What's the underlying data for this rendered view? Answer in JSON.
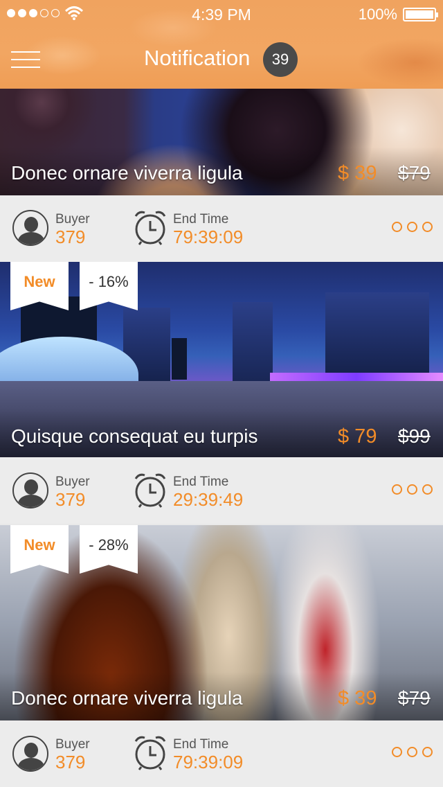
{
  "status_bar": {
    "time": "4:39 PM",
    "battery": "100%"
  },
  "nav": {
    "title": "Notification",
    "badge": "39"
  },
  "cards": [
    {
      "title": "Donec ornare viverra ligula",
      "price": "$ 39",
      "old_price": "$79",
      "buyer_label": "Buyer",
      "buyer_count": "379",
      "end_label": "End Time",
      "end_time": "79:39:09"
    },
    {
      "tag": "New",
      "discount": "- 16%",
      "title": "Quisque consequat eu turpis",
      "price": "$ 79",
      "old_price": "$99",
      "buyer_label": "Buyer",
      "buyer_count": "379",
      "end_label": "End Time",
      "end_time": "29:39:49"
    },
    {
      "tag": "New",
      "discount": "- 28%",
      "title": "Donec ornare viverra ligula",
      "price": "$ 39",
      "old_price": "$79",
      "buyer_label": "Buyer",
      "buyer_count": "379",
      "end_label": "End Time",
      "end_time": "79:39:09"
    }
  ],
  "colors": {
    "accent": "#f28c28",
    "header": "#f0a35f",
    "badge": "#4a4a4a"
  },
  "icons": [
    "menu-icon",
    "wifi-icon",
    "battery-icon",
    "user-icon",
    "alarm-clock-icon",
    "more-icon"
  ]
}
